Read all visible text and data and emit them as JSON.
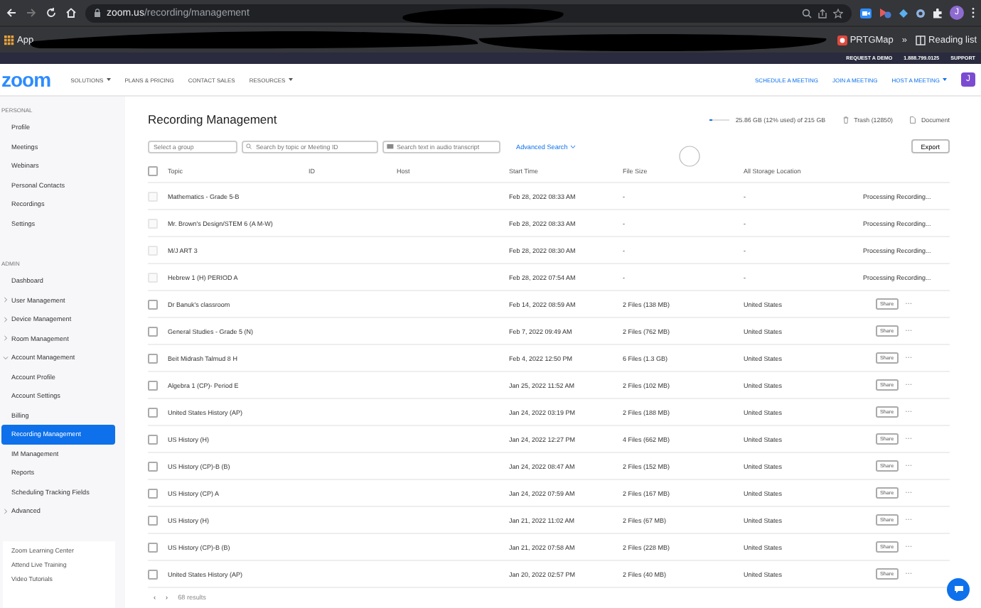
{
  "browser": {
    "url_host": "zoom.us",
    "url_path": "/recording/management",
    "profile_initial": "J",
    "bookmarks": [
      {
        "label": "App",
        "kind": "apps"
      },
      {
        "label": "PRTGMap",
        "kind": "site"
      },
      {
        "label": "»",
        "kind": "more"
      },
      {
        "label": "Reading list",
        "kind": "reading"
      }
    ]
  },
  "top_bar": {
    "links": [
      "REQUEST A DEMO",
      "1.888.799.0125",
      "SUPPORT"
    ]
  },
  "nav": {
    "logo": "zoom",
    "links": [
      {
        "label": "SOLUTIONS",
        "dropdown": true
      },
      {
        "label": "PLANS & PRICING",
        "dropdown": false
      },
      {
        "label": "CONTACT SALES",
        "dropdown": false
      },
      {
        "label": "RESOURCES",
        "dropdown": true
      }
    ],
    "right_links": [
      {
        "label": "SCHEDULE A MEETING",
        "dropdown": false
      },
      {
        "label": "JOIN A MEETING",
        "dropdown": false
      },
      {
        "label": "HOST A MEETING",
        "dropdown": true
      }
    ],
    "avatar": "J"
  },
  "sidebar": {
    "sections": [
      {
        "title": "PERSONAL",
        "items": [
          {
            "label": "Profile",
            "selected": false
          },
          {
            "label": "Meetings",
            "selected": false
          },
          {
            "label": "Webinars",
            "selected": false
          },
          {
            "label": "Personal Contacts",
            "selected": false
          },
          {
            "label": "Recordings",
            "selected": false
          },
          {
            "label": "Settings",
            "selected": false
          }
        ]
      },
      {
        "title": "ADMIN",
        "items": [
          {
            "label": "Dashboard",
            "selected": false
          },
          {
            "label": "User Management",
            "selected": false,
            "expanded": false
          },
          {
            "label": "Device Management",
            "selected": false,
            "expanded": false
          },
          {
            "label": "Room Management",
            "selected": false,
            "expanded": false
          },
          {
            "label": "Account Management",
            "selected": false,
            "expanded": true,
            "children": [
              {
                "label": "Account Profile",
                "selected": false
              },
              {
                "label": "Account Settings",
                "selected": false
              },
              {
                "label": "Billing",
                "selected": false
              },
              {
                "label": "Recording Management",
                "selected": true
              },
              {
                "label": "IM Management",
                "selected": false
              },
              {
                "label": "Reports",
                "selected": false
              },
              {
                "label": "Scheduling Tracking Fields",
                "selected": false
              }
            ]
          },
          {
            "label": "Advanced",
            "selected": false,
            "expanded": false
          }
        ]
      }
    ],
    "help_links": [
      "Zoom Learning Center",
      "Attend Live Training",
      "Video Tutorials"
    ]
  },
  "main": {
    "title": "Recording Management",
    "storage": {
      "level": 0.12,
      "text": "25.86 GB (12% used) of 215 GB"
    },
    "trash": "Trash (12850)",
    "document": "Document",
    "filters": {
      "group": {
        "placeholder": "Select a group"
      },
      "topic": {
        "placeholder": "Search by topic or Meeting ID"
      },
      "transcript": {
        "placeholder": "Search text in audio transcript"
      }
    },
    "advanced_search": "Advanced Search",
    "export": "Export",
    "table": {
      "select_all": {
        "checked": false
      },
      "columns": [
        "Topic",
        "ID",
        "Host",
        "Start Time",
        "File Size",
        "All Storage Location"
      ],
      "rows": [
        {
          "kind": "processing",
          "topic": "Mathematics - Grade 5-B",
          "start": "Feb 28, 2022 08:33 AM",
          "size": "-",
          "location": "-",
          "status": "Processing Recording..."
        },
        {
          "kind": "processing",
          "topic": "Mr. Brown's Design/STEM 6 (A M-W)",
          "start": "Feb 28, 2022 08:33 AM",
          "size": "-",
          "location": "-",
          "status": "Processing Recording..."
        },
        {
          "kind": "processing",
          "topic": "M/J ART 3",
          "start": "Feb 28, 2022 08:30 AM",
          "size": "-",
          "location": "-",
          "status": "Processing Recording..."
        },
        {
          "kind": "processing",
          "topic": "Hebrew 1 (H) PERIOD A",
          "start": "Feb 28, 2022 07:54 AM",
          "size": "-",
          "location": "-",
          "status": "Processing Recording..."
        },
        {
          "kind": "ready",
          "topic": "Dr Banuk's classroom",
          "start": "Feb 14, 2022 08:59 AM",
          "size": "2 Files (138 MB)",
          "location": "United States",
          "share": "Share",
          "more": "···"
        },
        {
          "kind": "ready",
          "topic": "General Studies - Grade 5 (N)",
          "start": "Feb 7, 2022 09:49 AM",
          "size": "2 Files (762 MB)",
          "location": "United States",
          "share": "Share",
          "more": "···"
        },
        {
          "kind": "ready",
          "topic": "Beit Midrash Talmud 8 H",
          "start": "Feb 4, 2022 12:50 PM",
          "size": "6 Files (1.3 GB)",
          "location": "United States",
          "share": "Share",
          "more": "···"
        },
        {
          "kind": "ready",
          "topic": "Algebra 1 (CP)- Period E",
          "start": "Jan 25, 2022 11:52 AM",
          "size": "2 Files (102 MB)",
          "location": "United States",
          "share": "Share",
          "more": "···"
        },
        {
          "kind": "ready",
          "topic": "United States History (AP)",
          "start": "Jan 24, 2022 03:19 PM",
          "size": "2 Files (188 MB)",
          "location": "United States",
          "share": "Share",
          "more": "···"
        },
        {
          "kind": "ready",
          "topic": "US History (H)",
          "start": "Jan 24, 2022 12:27 PM",
          "size": "4 Files (662 MB)",
          "location": "United States",
          "share": "Share",
          "more": "···"
        },
        {
          "kind": "ready",
          "topic": "US History (CP)-B (B)",
          "start": "Jan 24, 2022 08:47 AM",
          "size": "2 Files (152 MB)",
          "location": "United States",
          "share": "Share",
          "more": "···"
        },
        {
          "kind": "ready",
          "topic": "US History (CP) A",
          "start": "Jan 24, 2022 07:59 AM",
          "size": "2 Files (167 MB)",
          "location": "United States",
          "share": "Share",
          "more": "···"
        },
        {
          "kind": "ready",
          "topic": "US History (H)",
          "start": "Jan 21, 2022 11:02 AM",
          "size": "2 Files (67 MB)",
          "location": "United States",
          "share": "Share",
          "more": "···"
        },
        {
          "kind": "ready",
          "topic": "US History (CP)-B (B)",
          "start": "Jan 21, 2022 07:58 AM",
          "size": "2 Files (228 MB)",
          "location": "United States",
          "share": "Share",
          "more": "···"
        },
        {
          "kind": "ready",
          "topic": "United States History (AP)",
          "start": "Jan 20, 2022 02:57 PM",
          "size": "2 Files (40 MB)",
          "location": "United States",
          "share": "Share",
          "more": "···"
        }
      ]
    },
    "pagination": {
      "prev": "‹",
      "next": "›",
      "results": "68 results"
    }
  }
}
